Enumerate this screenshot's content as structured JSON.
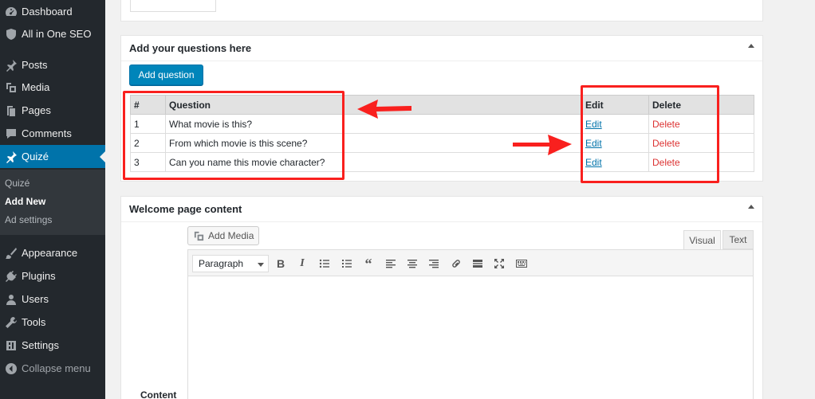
{
  "sidebar": {
    "items": [
      {
        "label": "Dashboard",
        "icon": "dashboard-icon"
      },
      {
        "label": "All in One SEO",
        "icon": "shield-icon"
      },
      {
        "label": "Posts",
        "icon": "pin-icon"
      },
      {
        "label": "Media",
        "icon": "media-icon"
      },
      {
        "label": "Pages",
        "icon": "pages-icon"
      },
      {
        "label": "Comments",
        "icon": "comments-icon"
      },
      {
        "label": "Quizé",
        "icon": "pin-icon"
      },
      {
        "label": "Appearance",
        "icon": "brush-icon"
      },
      {
        "label": "Plugins",
        "icon": "plugin-icon"
      },
      {
        "label": "Users",
        "icon": "users-icon"
      },
      {
        "label": "Tools",
        "icon": "wrench-icon"
      },
      {
        "label": "Settings",
        "icon": "settings-icon"
      },
      {
        "label": "Collapse menu",
        "icon": "collapse-icon"
      }
    ],
    "submenu": [
      "Quizé",
      "Add New",
      "Ad settings"
    ]
  },
  "questions_box": {
    "title": "Add your questions here",
    "add_button": "Add question",
    "headers": [
      "#",
      "Question",
      "Edit",
      "Delete"
    ],
    "rows": [
      {
        "num": "1",
        "question": "What movie is this?",
        "edit": "Edit",
        "delete": "Delete"
      },
      {
        "num": "2",
        "question": "From which movie is this scene?",
        "edit": "Edit",
        "delete": "Delete"
      },
      {
        "num": "3",
        "question": "Can you name this movie character?",
        "edit": "Edit",
        "delete": "Delete"
      }
    ]
  },
  "welcome_box": {
    "title": "Welcome page content",
    "add_media": "Add Media",
    "tab_visual": "Visual",
    "tab_text": "Text",
    "format": "Paragraph",
    "content_label": "Content"
  },
  "colors": {
    "accent": "#0073aa",
    "highlight": "#f9201e",
    "delete": "#dc3232"
  }
}
